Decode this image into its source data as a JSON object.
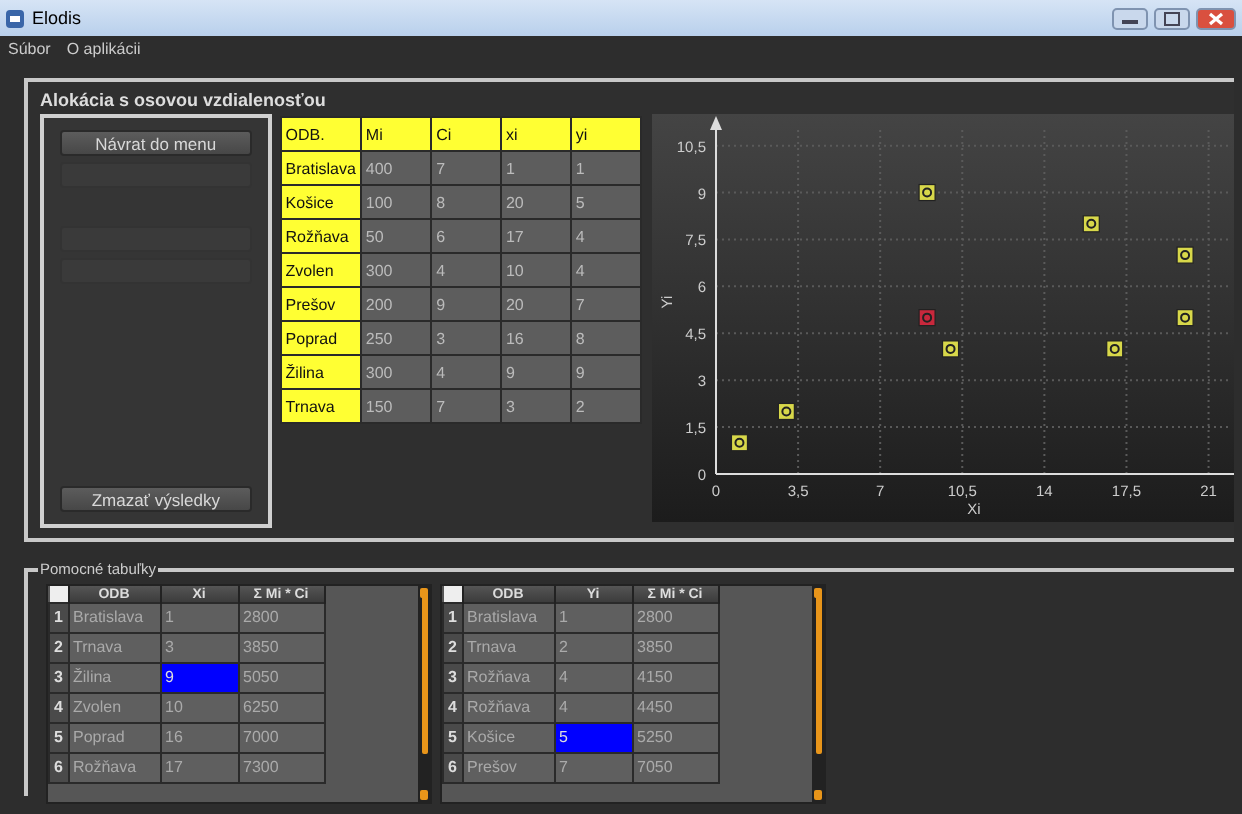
{
  "window": {
    "title": "Elodis"
  },
  "menu": [
    {
      "label": "Súbor"
    },
    {
      "label": "O aplikácii"
    }
  ],
  "allocation": {
    "title": "Alokácia s osovou vzdialenosťou",
    "buttons": [
      {
        "label": "Návrat do menu",
        "disabled": false
      },
      {
        "disabled": true
      },
      {
        "disabled": true
      },
      {
        "disabled": true
      }
    ],
    "clear_button": {
      "label": "Zmazať výsledky",
      "disabled": false
    },
    "table": {
      "columns": [
        "ODB.",
        "Mi",
        "Ci",
        "xi",
        "yi"
      ],
      "rows": [
        [
          "Bratislava",
          "400",
          "7",
          "1",
          "1"
        ],
        [
          "Košice",
          "100",
          "8",
          "20",
          "5"
        ],
        [
          "Rožňava",
          "50",
          "6",
          "17",
          "4"
        ],
        [
          "Zvolen",
          "300",
          "4",
          "10",
          "4"
        ],
        [
          "Prešov",
          "200",
          "9",
          "20",
          "7"
        ],
        [
          "Poprad",
          "250",
          "3",
          "16",
          "8"
        ],
        [
          "Žilina",
          "300",
          "4",
          "9",
          "9"
        ],
        [
          "Trnava",
          "150",
          "7",
          "3",
          "2"
        ]
      ]
    },
    "chart_data": {
      "type": "scatter",
      "grid": true,
      "xlabel": "Xi",
      "ylabel": "Yi",
      "xlim": [
        0,
        22
      ],
      "ylim": [
        0,
        11
      ],
      "xticks": [
        {
          "value": 0,
          "label": "0"
        },
        {
          "value": 3.5,
          "label": "3,5"
        },
        {
          "value": 7,
          "label": "7"
        },
        {
          "value": 10.5,
          "label": "10,5"
        },
        {
          "value": 14,
          "label": "14"
        },
        {
          "value": 17.5,
          "label": "17,5"
        },
        {
          "value": 21,
          "label": "21"
        }
      ],
      "yticks": [
        {
          "value": 0,
          "label": "0"
        },
        {
          "value": 1.5,
          "label": "1,5"
        },
        {
          "value": 3,
          "label": "3"
        },
        {
          "value": 4.5,
          "label": "4,5"
        },
        {
          "value": 6,
          "label": "6"
        },
        {
          "value": 7.5,
          "label": "7,5"
        },
        {
          "value": 9,
          "label": "9"
        },
        {
          "value": 10.5,
          "label": "10,5"
        }
      ],
      "series": [
        {
          "color": "#d8d84a",
          "x": [
            1,
            20,
            17,
            10,
            20,
            16,
            9,
            3
          ],
          "values": [
            1,
            5,
            4,
            4,
            7,
            8,
            9,
            2
          ]
        },
        {
          "color": "#c8283c",
          "x": [
            9
          ],
          "values": [
            5
          ]
        }
      ]
    }
  },
  "helper": {
    "title": "Pomocné tabuľky",
    "tables": [
      {
        "columns": [
          "ODB",
          "Xi",
          "Σ Mi * Ci"
        ],
        "rows": [
          {
            "number": "1",
            "cells": [
              "Bratislava",
              "1",
              "2800"
            ],
            "selected": false
          },
          {
            "number": "2",
            "cells": [
              "Trnava",
              "3",
              "3850"
            ],
            "selected": false
          },
          {
            "number": "3",
            "cells": [
              "Žilina",
              "9",
              "5050"
            ],
            "selected": true
          },
          {
            "number": "4",
            "cells": [
              "Zvolen",
              "10",
              "6250"
            ],
            "selected": false
          },
          {
            "number": "5",
            "cells": [
              "Poprad",
              "16",
              "7000"
            ],
            "selected": false
          },
          {
            "number": "6",
            "cells": [
              "Rožňava",
              "17",
              "7300"
            ],
            "selected": false
          }
        ]
      },
      {
        "columns": [
          "ODB",
          "Yi",
          "Σ Mi * Ci"
        ],
        "rows": [
          {
            "number": "1",
            "cells": [
              "Bratislava",
              "1",
              "2800"
            ],
            "selected": false
          },
          {
            "number": "2",
            "cells": [
              "Trnava",
              "2",
              "3850"
            ],
            "selected": false
          },
          {
            "number": "3",
            "cells": [
              "Rožňava",
              "4",
              "4150"
            ],
            "selected": false
          },
          {
            "number": "4",
            "cells": [
              "Rožňava",
              "4",
              "4450"
            ],
            "selected": false
          },
          {
            "number": "5",
            "cells": [
              "Košice",
              "5",
              "5250"
            ],
            "selected": true
          },
          {
            "number": "6",
            "cells": [
              "Prešov",
              "7",
              "7050"
            ],
            "selected": false
          }
        ]
      }
    ]
  }
}
